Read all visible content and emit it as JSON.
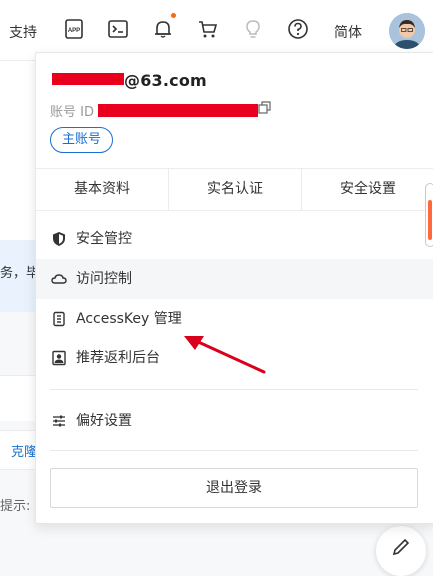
{
  "topbar": {
    "support_label": "支持",
    "lang_label": "简体",
    "icons": [
      "app-icon",
      "terminal-icon",
      "bell-icon",
      "cart-icon",
      "lightbulb-icon",
      "help-icon",
      "avatar"
    ],
    "notification_dot_color": "#ff6a00"
  },
  "background": {
    "info_text": "务，毕",
    "link_text": "克隆",
    "hint_text": "提示:"
  },
  "account": {
    "name_suffix": "63.com",
    "id_label": "账号 ID",
    "tag": "主账号"
  },
  "tabs": [
    {
      "label": "基本资料"
    },
    {
      "label": "实名认证"
    },
    {
      "label": "安全设置"
    }
  ],
  "menu": {
    "items": [
      {
        "label": "安全管控",
        "icon": "shield-icon"
      },
      {
        "label": "访问控制",
        "icon": "cloud-icon"
      },
      {
        "label": "AccessKey 管理",
        "icon": "key-icon"
      },
      {
        "label": "推荐返利后台",
        "icon": "person-card-icon"
      },
      {
        "label": "偏好设置",
        "icon": "sliders-icon"
      }
    ]
  },
  "logout_label": "退出登录",
  "colors": {
    "accent": "#1a6fd1",
    "redaction": "#e8001e",
    "annotation_arrow": "#d9001b"
  }
}
